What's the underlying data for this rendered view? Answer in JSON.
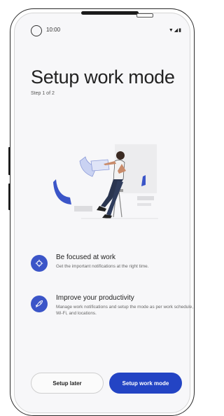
{
  "status_bar": {
    "time": "10:00",
    "icons": [
      "wifi-icon",
      "signal-icon",
      "battery-icon"
    ]
  },
  "header": {
    "title": "Setup work mode",
    "step": "Step 1 of 2"
  },
  "features": [
    {
      "icon": "focus-icon",
      "title": "Be focused at work",
      "description": "Get the important notifications at the right  time."
    },
    {
      "icon": "rocket-icon",
      "title": "Improve your productivity",
      "description": "Manage work notifications and setup the mode as per work schedule, Wi-Fi, and locations."
    }
  ],
  "actions": {
    "secondary_label": "Setup later",
    "primary_label": "Setup work mode"
  },
  "colors": {
    "accent": "#2344c4",
    "icon_bg": "#3b55c8",
    "background": "#f7f7f9"
  }
}
